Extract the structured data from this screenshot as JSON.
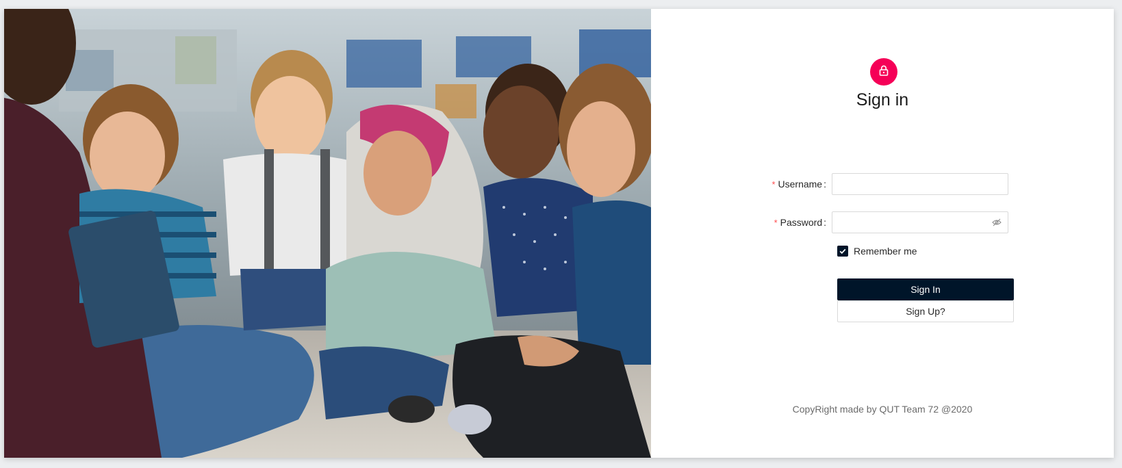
{
  "colors": {
    "accent": "#f50057",
    "primary_button": "#001529",
    "required_marker": "#ff4d4f"
  },
  "hero": {
    "image": "photo-of-children-sitting-on-classroom-floor"
  },
  "login": {
    "icon": "lock-outline-icon",
    "title": "Sign in",
    "username": {
      "required_marker": "*",
      "label": "Username",
      "colon": ":",
      "value": ""
    },
    "password": {
      "required_marker": "*",
      "label": "Password",
      "colon": ":",
      "value": "",
      "toggle_icon": "eye-invisible-icon"
    },
    "remember": {
      "label": "Remember me",
      "checked": true
    },
    "sign_in_label": "Sign In",
    "sign_up_label": "Sign Up?",
    "copyright": "CopyRight made by QUT Team 72 @2020"
  }
}
